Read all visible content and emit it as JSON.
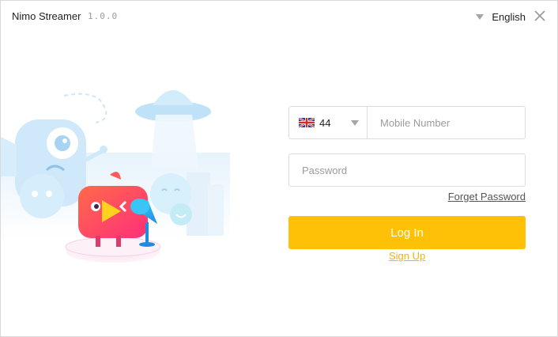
{
  "window": {
    "title": "Nimo Streamer",
    "version": "1.0.0"
  },
  "header": {
    "language_label": "English",
    "language_caret_icon": "caret-down-icon",
    "close_icon": "close-icon"
  },
  "illustration": {
    "description_icon": "mascot-illustration"
  },
  "login_form": {
    "country": {
      "flag_icon": "uk-flag-icon",
      "code": "44",
      "caret_icon": "caret-down-icon"
    },
    "mobile_placeholder": "Mobile Number",
    "password_placeholder": "Password",
    "forget_password_label": "Forget Password",
    "login_label": "Log In",
    "signup_label": "Sign Up"
  },
  "colors": {
    "accent": "#ffc107",
    "signup_link": "#f5b400",
    "border": "#dcdcdc"
  }
}
